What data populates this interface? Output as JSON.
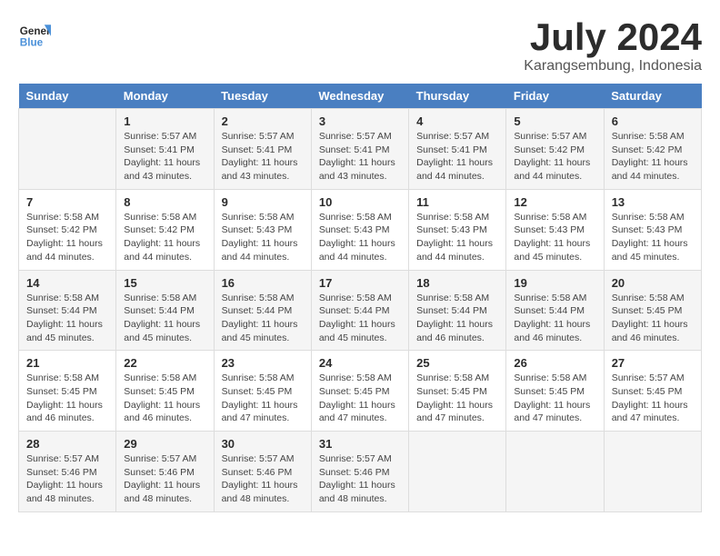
{
  "logo": {
    "text_general": "General",
    "text_blue": "Blue"
  },
  "title": "July 2024",
  "subtitle": "Karangsembung, Indonesia",
  "header": {
    "days": [
      "Sunday",
      "Monday",
      "Tuesday",
      "Wednesday",
      "Thursday",
      "Friday",
      "Saturday"
    ]
  },
  "weeks": [
    {
      "cells": [
        {
          "day": "",
          "info": ""
        },
        {
          "day": "1",
          "info": "Sunrise: 5:57 AM\nSunset: 5:41 PM\nDaylight: 11 hours\nand 43 minutes."
        },
        {
          "day": "2",
          "info": "Sunrise: 5:57 AM\nSunset: 5:41 PM\nDaylight: 11 hours\nand 43 minutes."
        },
        {
          "day": "3",
          "info": "Sunrise: 5:57 AM\nSunset: 5:41 PM\nDaylight: 11 hours\nand 43 minutes."
        },
        {
          "day": "4",
          "info": "Sunrise: 5:57 AM\nSunset: 5:41 PM\nDaylight: 11 hours\nand 44 minutes."
        },
        {
          "day": "5",
          "info": "Sunrise: 5:57 AM\nSunset: 5:42 PM\nDaylight: 11 hours\nand 44 minutes."
        },
        {
          "day": "6",
          "info": "Sunrise: 5:58 AM\nSunset: 5:42 PM\nDaylight: 11 hours\nand 44 minutes."
        }
      ]
    },
    {
      "cells": [
        {
          "day": "7",
          "info": "Sunrise: 5:58 AM\nSunset: 5:42 PM\nDaylight: 11 hours\nand 44 minutes."
        },
        {
          "day": "8",
          "info": "Sunrise: 5:58 AM\nSunset: 5:42 PM\nDaylight: 11 hours\nand 44 minutes."
        },
        {
          "day": "9",
          "info": "Sunrise: 5:58 AM\nSunset: 5:43 PM\nDaylight: 11 hours\nand 44 minutes."
        },
        {
          "day": "10",
          "info": "Sunrise: 5:58 AM\nSunset: 5:43 PM\nDaylight: 11 hours\nand 44 minutes."
        },
        {
          "day": "11",
          "info": "Sunrise: 5:58 AM\nSunset: 5:43 PM\nDaylight: 11 hours\nand 44 minutes."
        },
        {
          "day": "12",
          "info": "Sunrise: 5:58 AM\nSunset: 5:43 PM\nDaylight: 11 hours\nand 45 minutes."
        },
        {
          "day": "13",
          "info": "Sunrise: 5:58 AM\nSunset: 5:43 PM\nDaylight: 11 hours\nand 45 minutes."
        }
      ]
    },
    {
      "cells": [
        {
          "day": "14",
          "info": "Sunrise: 5:58 AM\nSunset: 5:44 PM\nDaylight: 11 hours\nand 45 minutes."
        },
        {
          "day": "15",
          "info": "Sunrise: 5:58 AM\nSunset: 5:44 PM\nDaylight: 11 hours\nand 45 minutes."
        },
        {
          "day": "16",
          "info": "Sunrise: 5:58 AM\nSunset: 5:44 PM\nDaylight: 11 hours\nand 45 minutes."
        },
        {
          "day": "17",
          "info": "Sunrise: 5:58 AM\nSunset: 5:44 PM\nDaylight: 11 hours\nand 45 minutes."
        },
        {
          "day": "18",
          "info": "Sunrise: 5:58 AM\nSunset: 5:44 PM\nDaylight: 11 hours\nand 46 minutes."
        },
        {
          "day": "19",
          "info": "Sunrise: 5:58 AM\nSunset: 5:44 PM\nDaylight: 11 hours\nand 46 minutes."
        },
        {
          "day": "20",
          "info": "Sunrise: 5:58 AM\nSunset: 5:45 PM\nDaylight: 11 hours\nand 46 minutes."
        }
      ]
    },
    {
      "cells": [
        {
          "day": "21",
          "info": "Sunrise: 5:58 AM\nSunset: 5:45 PM\nDaylight: 11 hours\nand 46 minutes."
        },
        {
          "day": "22",
          "info": "Sunrise: 5:58 AM\nSunset: 5:45 PM\nDaylight: 11 hours\nand 46 minutes."
        },
        {
          "day": "23",
          "info": "Sunrise: 5:58 AM\nSunset: 5:45 PM\nDaylight: 11 hours\nand 47 minutes."
        },
        {
          "day": "24",
          "info": "Sunrise: 5:58 AM\nSunset: 5:45 PM\nDaylight: 11 hours\nand 47 minutes."
        },
        {
          "day": "25",
          "info": "Sunrise: 5:58 AM\nSunset: 5:45 PM\nDaylight: 11 hours\nand 47 minutes."
        },
        {
          "day": "26",
          "info": "Sunrise: 5:58 AM\nSunset: 5:45 PM\nDaylight: 11 hours\nand 47 minutes."
        },
        {
          "day": "27",
          "info": "Sunrise: 5:57 AM\nSunset: 5:45 PM\nDaylight: 11 hours\nand 47 minutes."
        }
      ]
    },
    {
      "cells": [
        {
          "day": "28",
          "info": "Sunrise: 5:57 AM\nSunset: 5:46 PM\nDaylight: 11 hours\nand 48 minutes."
        },
        {
          "day": "29",
          "info": "Sunrise: 5:57 AM\nSunset: 5:46 PM\nDaylight: 11 hours\nand 48 minutes."
        },
        {
          "day": "30",
          "info": "Sunrise: 5:57 AM\nSunset: 5:46 PM\nDaylight: 11 hours\nand 48 minutes."
        },
        {
          "day": "31",
          "info": "Sunrise: 5:57 AM\nSunset: 5:46 PM\nDaylight: 11 hours\nand 48 minutes."
        },
        {
          "day": "",
          "info": ""
        },
        {
          "day": "",
          "info": ""
        },
        {
          "day": "",
          "info": ""
        }
      ]
    }
  ]
}
